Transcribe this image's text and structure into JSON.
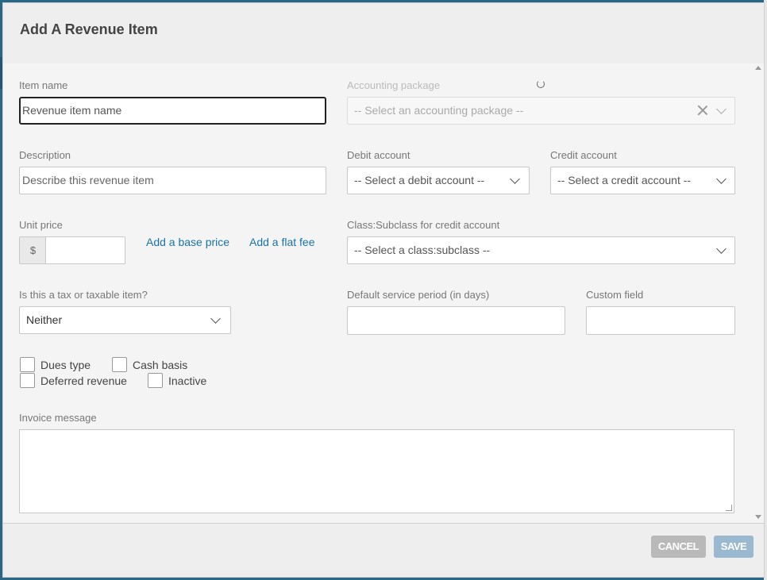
{
  "modal": {
    "title": "Add A Revenue Item"
  },
  "form": {
    "item_name": {
      "label": "Item name",
      "value": "Revenue item name"
    },
    "accounting_package": {
      "label": "Accounting package",
      "placeholder": "-- Select an accounting package --"
    },
    "description": {
      "label": "Description",
      "value": "Describe this revenue item"
    },
    "debit_account": {
      "label": "Debit account",
      "placeholder": "-- Select a debit account --"
    },
    "credit_account": {
      "label": "Credit account",
      "placeholder": "-- Select a credit account --"
    },
    "unit_price": {
      "label": "Unit price",
      "currency_symbol": "$",
      "value": ""
    },
    "links": {
      "add_base_price": "Add a base price",
      "add_flat_fee": "Add a flat fee"
    },
    "class_subclass": {
      "label": "Class:Subclass for credit account",
      "placeholder": "-- Select a class:subclass --"
    },
    "tax": {
      "label": "Is this a tax or taxable item?",
      "selected": "Neither"
    },
    "service_period": {
      "label": "Default service period (in days)",
      "value": ""
    },
    "custom_field": {
      "label": "Custom field",
      "value": ""
    },
    "checkboxes": {
      "dues_type": "Dues type",
      "cash_basis": "Cash basis",
      "deferred_revenue": "Deferred revenue",
      "inactive": "Inactive"
    },
    "invoice_message": {
      "label": "Invoice message",
      "value": ""
    }
  },
  "footer": {
    "cancel_label": "CANCEL",
    "save_label": "SAVE"
  },
  "colors": {
    "link": "#1a73a8",
    "save_button": "#9ab8cf",
    "cancel_button": "#b9b9b9"
  }
}
